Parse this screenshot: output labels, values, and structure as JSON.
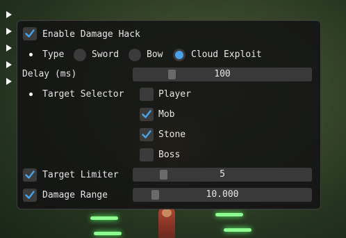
{
  "menu": {
    "enable_damage_hack": {
      "label": "Enable Damage Hack",
      "checked": true
    },
    "type": {
      "label": "Type",
      "options": [
        "Sword",
        "Bow",
        "Cloud Exploit"
      ],
      "selected": "Cloud Exploit"
    },
    "delay": {
      "label": "Delay (ms)",
      "value": "100",
      "fraction": 0.2
    },
    "target_selector": {
      "label": "Target Selector",
      "options": [
        {
          "label": "Player",
          "checked": false
        },
        {
          "label": "Mob",
          "checked": true
        },
        {
          "label": "Stone",
          "checked": true
        },
        {
          "label": "Boss",
          "checked": false
        }
      ]
    },
    "target_limiter": {
      "label": "Target Limiter",
      "checked": true,
      "value": "5",
      "fraction": 0.15
    },
    "damage_range": {
      "label": "Damage Range",
      "checked": true,
      "value": "10.000",
      "fraction": 0.1
    }
  },
  "colors": {
    "accent": "#4aa3e8",
    "panel_bg": "#141414",
    "widget_bg": "#3b3b3b",
    "text": "#e6e6e6"
  }
}
